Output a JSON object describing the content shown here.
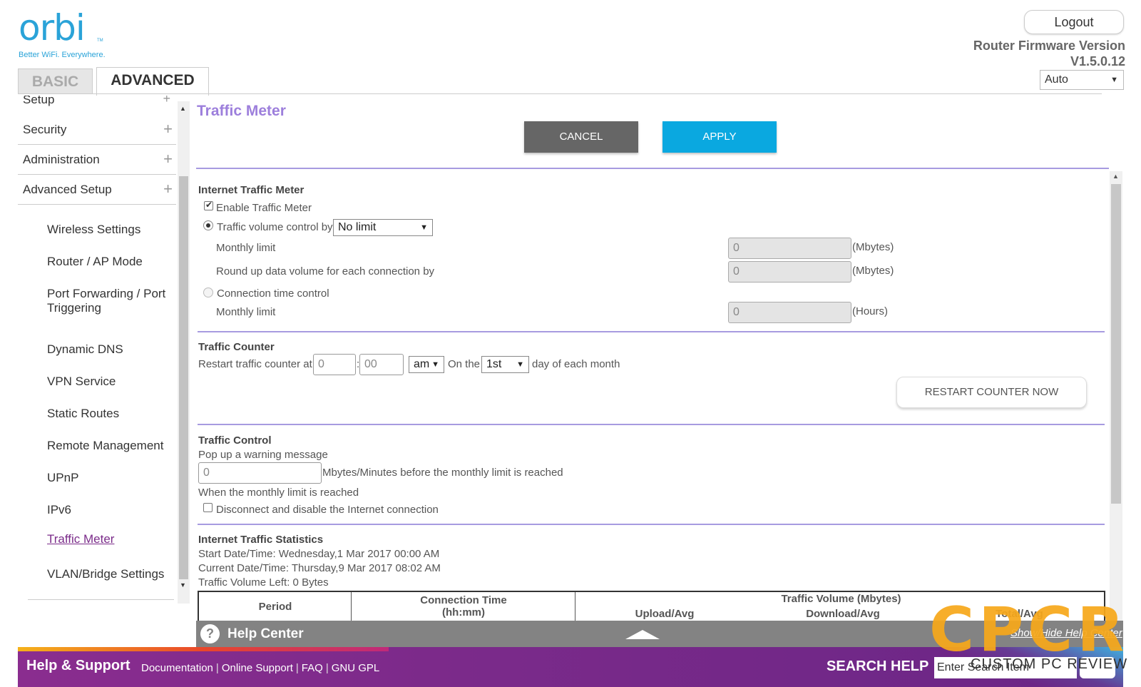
{
  "brand": {
    "logo_text": "orbi",
    "tagline": "Better WiFi. Everywhere.",
    "tm": "TM"
  },
  "tabs": {
    "basic": "BASIC",
    "advanced": "ADVANCED"
  },
  "header": {
    "logout": "Logout",
    "firmware_label": "Router Firmware Version",
    "firmware_version": "V1.5.0.12",
    "language": "Auto"
  },
  "sidebar": {
    "top_partial": "Setup",
    "sections": [
      {
        "label": "Security"
      },
      {
        "label": "Administration"
      },
      {
        "label": "Advanced Setup"
      }
    ],
    "items": [
      {
        "label": "Wireless Settings"
      },
      {
        "label": "Router / AP Mode"
      },
      {
        "label": "Port Forwarding / Port Triggering"
      },
      {
        "label": "Dynamic DNS"
      },
      {
        "label": "VPN Service"
      },
      {
        "label": "Static Routes"
      },
      {
        "label": "Remote Management"
      },
      {
        "label": "UPnP"
      },
      {
        "label": "IPv6"
      },
      {
        "label": "Traffic Meter"
      },
      {
        "label": "VLAN/Bridge Settings"
      }
    ]
  },
  "main": {
    "title": "Traffic Meter",
    "cancel": "CANCEL",
    "apply": "APPLY",
    "itm": {
      "heading": "Internet Traffic Meter",
      "enable": "Enable Traffic Meter",
      "enable_checked": true,
      "volume_control": "Traffic volume control by",
      "volume_option": "No limit",
      "monthly_limit": "Monthly limit",
      "monthly_value": "0",
      "mbytes": "(Mbytes)",
      "roundup": "Round up data volume for each connection by",
      "roundup_value": "0",
      "time_control": "Connection time control",
      "time_monthly_limit": "Monthly limit",
      "time_value": "0",
      "hours": "(Hours)"
    },
    "counter": {
      "heading": "Traffic Counter",
      "restart_at": "Restart traffic counter at",
      "hour": "0",
      "minute": "00",
      "colon": ":",
      "ampm": "am",
      "on_the": "On the",
      "day": "1st",
      "day_suffix": "day of each month",
      "restart_now": "RESTART COUNTER NOW"
    },
    "control": {
      "heading": "Traffic Control",
      "popup": "Pop up a warning message",
      "warn_value": "0",
      "warn_suffix": "Mbytes/Minutes before the monthly limit is reached",
      "when_reached": "When the monthly limit is reached",
      "disconnect": "Disconnect and disable the Internet connection",
      "disconnect_checked": false
    },
    "stats": {
      "heading": "Internet Traffic Statistics",
      "start": "Start Date/Time: Wednesday,1 Mar 2017 00:00 AM",
      "current": "Current Date/Time: Thursday,9 Mar 2017 08:02 AM",
      "left": "Traffic Volume Left: 0 Bytes",
      "col_period": "Period",
      "col_conn_time": "Connection Time",
      "col_conn_unit": "(hh:mm)",
      "col_volume": "Traffic Volume (Mbytes)",
      "col_upload": "Upload/Avg",
      "col_download": "Download/Avg",
      "col_total": "Total/Avg"
    }
  },
  "help_center": {
    "title": "Help Center",
    "q": "?",
    "toggle": "Show/Hide Help Center"
  },
  "footer": {
    "help_support": "Help & Support",
    "links": [
      "Documentation",
      "Online Support",
      "FAQ",
      "GNU GPL"
    ],
    "search_help": "SEARCH HELP",
    "search_placeholder": "Enter Search Item"
  },
  "watermark": {
    "big": "CPCR",
    "small": "CUSTOM PC REVIEW"
  },
  "colors": {
    "brand_blue": "#2aa3d8",
    "title_purple": "#9d7fdc",
    "apply_blue": "#0aa8e0",
    "cancel_gray": "#666666",
    "footer_purple": "#7b2a8a",
    "active_link": "#7b2c8a",
    "watermark_orange": "#f7a81b"
  }
}
